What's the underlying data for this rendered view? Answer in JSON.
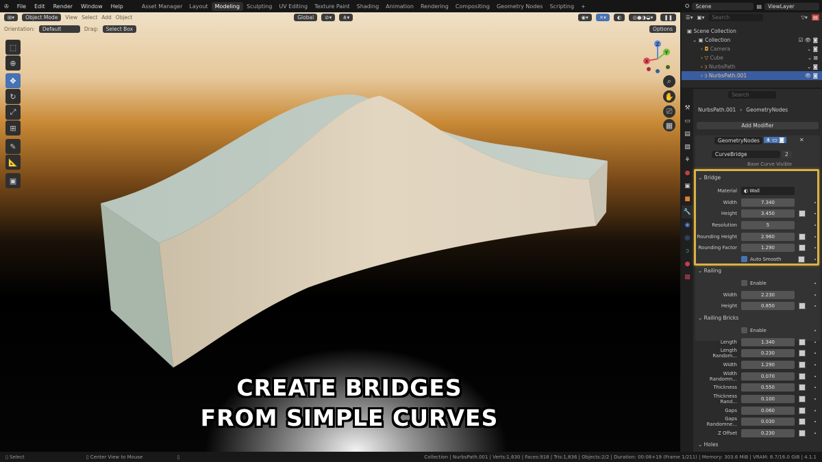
{
  "menu": [
    "File",
    "Edit",
    "Render",
    "Window",
    "Help"
  ],
  "workspaces": [
    "Asset Manager",
    "Layout",
    "Modeling",
    "Sculpting",
    "UV Editing",
    "Texture Paint",
    "Shading",
    "Animation",
    "Rendering",
    "Compositing",
    "Geometry Nodes",
    "Scripting"
  ],
  "active_workspace": "Modeling",
  "scene": "Scene",
  "view_layer": "ViewLayer",
  "viewport": {
    "mode": "Object Mode",
    "menus": [
      "View",
      "Select",
      "Add",
      "Object"
    ],
    "transform": "Global",
    "orientation_label": "Orientation:",
    "orientation": "Default",
    "drag_label": "Drag:",
    "drag": "Select Box",
    "options": "Options"
  },
  "gizmo": {
    "x": "X",
    "y": "Y",
    "z": "Z"
  },
  "caption": [
    "CREATE BRIDGES",
    "FROM SIMPLE CURVES"
  ],
  "outliner": {
    "search_placeholder": "Search",
    "root": "Scene Collection",
    "collection": "Collection",
    "items": [
      "Camera",
      "Cube",
      "NurbsPath",
      "NurbsPath.001"
    ],
    "selected": "NurbsPath.001"
  },
  "properties": {
    "search_placeholder": "Search",
    "breadcrumb": [
      "NurbsPath.001",
      "GeometryNodes"
    ],
    "add_modifier": "Add Modifier",
    "modifier_name": "GeometryNodes",
    "node_group": "CurveBridge",
    "users": "2",
    "base_curve": "Base Curve Visible",
    "bridge": {
      "title": "Bridge",
      "material_label": "Material",
      "material": "Wall",
      "fields": [
        {
          "label": "Width",
          "value": "7.340",
          "kf": false
        },
        {
          "label": "Height",
          "value": "3.450",
          "kf": true
        },
        {
          "label": "Resolution",
          "value": "5",
          "kf": false
        },
        {
          "label": "Rounding Height",
          "value": "2.960",
          "kf": true
        },
        {
          "label": "Rounding Factor",
          "value": "1.290",
          "kf": true
        }
      ],
      "auto_smooth": "Auto Smooth",
      "auto_smooth_on": true
    },
    "railing": {
      "title": "Railing",
      "enable": "Enable",
      "fields": [
        {
          "label": "Width",
          "value": "2.230",
          "kf": false
        },
        {
          "label": "Height",
          "value": "0.850",
          "kf": true
        }
      ]
    },
    "railing_bricks": {
      "title": "Railing Bricks",
      "enable": "Enable",
      "fields": [
        {
          "label": "Length",
          "value": "1.340"
        },
        {
          "label": "Length Random...",
          "value": "0.230"
        },
        {
          "label": "Width",
          "value": "1.290"
        },
        {
          "label": "Width Randomn...",
          "value": "0.070"
        },
        {
          "label": "Thickness",
          "value": "0.550"
        },
        {
          "label": "Thickness Rand...",
          "value": "0.100"
        },
        {
          "label": "Gaps",
          "value": "0.060"
        },
        {
          "label": "Gaps Randomne...",
          "value": "0.030"
        },
        {
          "label": "Z Offset",
          "value": "0.230"
        }
      ]
    },
    "holes": {
      "title": "Holes"
    }
  },
  "status": {
    "left": "Select",
    "middle": "Center View to Mouse",
    "right": "Collection | NurbsPath.001 | Verts:1,630 | Faces:918 | Tris:1,836 | Objects:2/2 | Duration: 00:08+19 (Frame 1/211) | Memory: 303.6 MiB | VRAM: 8.7/16.0 GiB | 4.1.1"
  },
  "colors": {
    "accent": "#4772b3",
    "highlight": "#d8b24a"
  }
}
